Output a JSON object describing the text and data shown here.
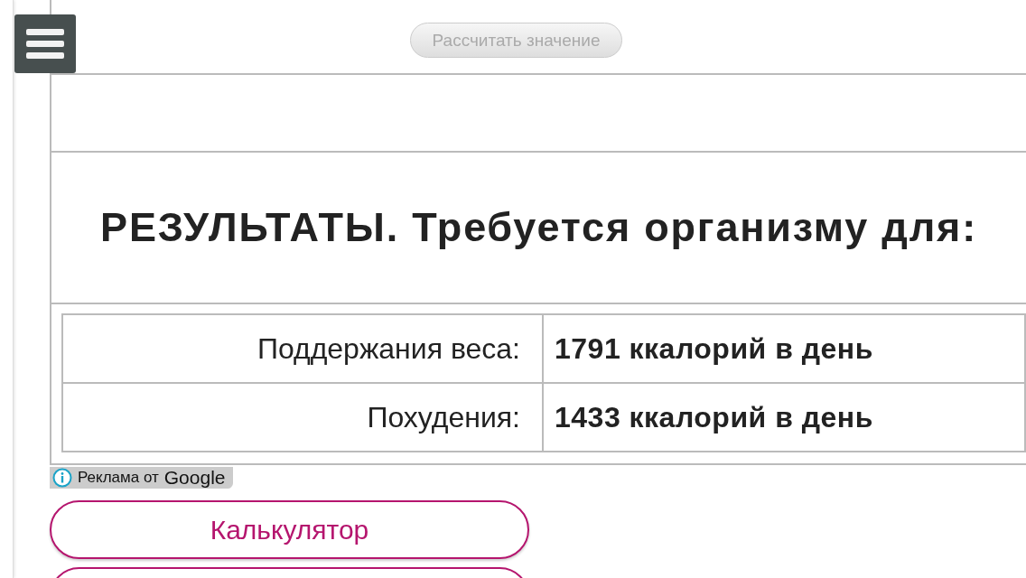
{
  "calculate_button": {
    "label": "Рассчитать значение",
    "disabled": true
  },
  "results": {
    "title": "РЕЗУЛЬТАТЫ. Требуется организму для:",
    "rows": [
      {
        "label": "Поддержания веса:",
        "value": "1791 ккалорий в день"
      },
      {
        "label": "Похудения:",
        "value": "1433 ккалорий в день"
      }
    ]
  },
  "ad_label": {
    "text": "Реклама от",
    "brand": "Google"
  },
  "nav_buttons": [
    {
      "kind": "labeled",
      "label": "Калькулятор"
    },
    {
      "kind": "cut_off"
    }
  ]
}
